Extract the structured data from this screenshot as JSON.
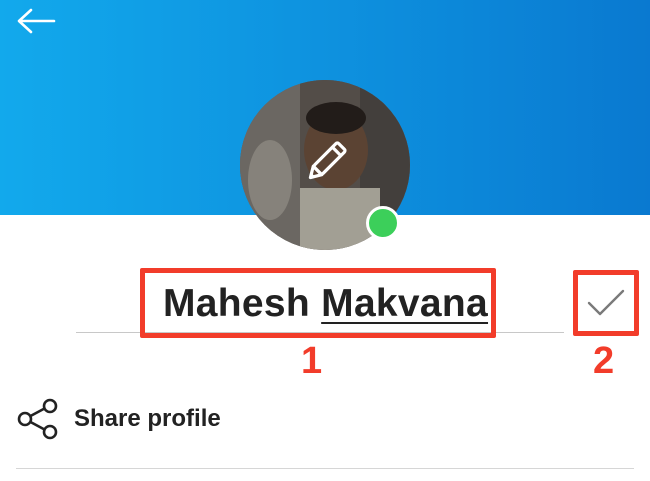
{
  "header": {
    "back_icon": "arrow-left-icon",
    "background_color": "#0d8ddc"
  },
  "profile": {
    "avatar_overlay_icon": "pencil-edit-icon",
    "online_status_color": "#3ccf5a",
    "first_name": "Mahesh",
    "last_name": "Makvana",
    "confirm_icon": "checkmark-icon"
  },
  "annotations": {
    "callout_1": "1",
    "callout_2": "2",
    "highlight_color": "#f23c2a"
  },
  "actions": {
    "share_icon": "share-icon",
    "share_label": "Share profile"
  }
}
